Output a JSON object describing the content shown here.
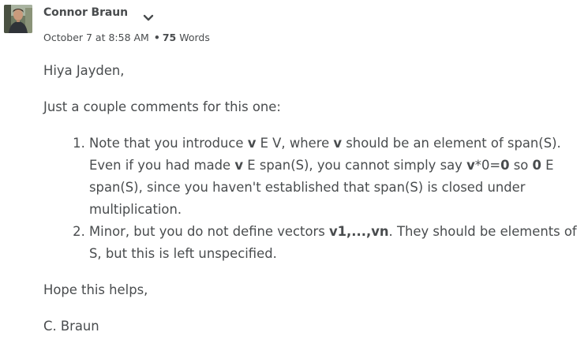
{
  "post": {
    "author": "Connor Braun",
    "avatar_icon": "user-photo",
    "menu_icon": "chevron-down-icon",
    "timestamp": "October 7 at 8:58 AM",
    "separator": "•",
    "word_count": "75",
    "word_label": "Words"
  },
  "message": {
    "greeting": "Hiya Jayden,",
    "intro": "Just a couple comments for this one:",
    "items": [
      {
        "runs": [
          {
            "t": "Note that you introduce ",
            "b": false
          },
          {
            "t": "v",
            "b": true
          },
          {
            "t": " E V, where ",
            "b": false
          },
          {
            "t": "v",
            "b": true
          },
          {
            "t": " should be an element of span(S). Even if you had made ",
            "b": false
          },
          {
            "t": "v",
            "b": true
          },
          {
            "t": " E span(S), you cannot simply say ",
            "b": false
          },
          {
            "t": "v",
            "b": true
          },
          {
            "t": "*0=",
            "b": false
          },
          {
            "t": "0",
            "b": true
          },
          {
            "t": " so ",
            "b": false
          },
          {
            "t": "0",
            "b": true
          },
          {
            "t": " E span(S), since you haven't established that span(S) is closed under multiplication.",
            "b": false
          }
        ]
      },
      {
        "runs": [
          {
            "t": "Minor, but you do not define vectors ",
            "b": false
          },
          {
            "t": "v1,...,vn",
            "b": true
          },
          {
            "t": ". They should be elements of S, but this is left unspecified.",
            "b": false
          }
        ]
      }
    ],
    "closing": "Hope this helps,",
    "signature": "C. Braun"
  }
}
